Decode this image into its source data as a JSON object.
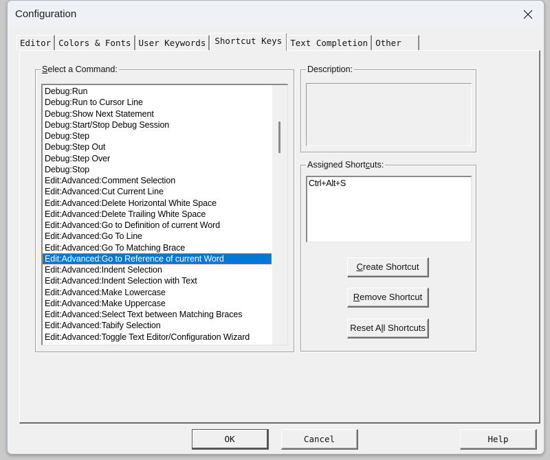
{
  "window": {
    "title": "Configuration",
    "close_icon": "close-icon"
  },
  "tabs": [
    {
      "label": "Editor",
      "active": false
    },
    {
      "label": "Colors & Fonts",
      "active": false
    },
    {
      "label": "User Keywords",
      "active": false
    },
    {
      "label": "Shortcut Keys",
      "active": true
    },
    {
      "label": "Text Completion",
      "active": false
    },
    {
      "label": "Other",
      "active": false
    }
  ],
  "commands": {
    "label_access": "S",
    "label_rest": "elect a Command:",
    "selected_index": 15,
    "items": [
      "Debug:Run",
      "Debug:Run to Cursor Line",
      "Debug:Show Next Statement",
      "Debug:Start/Stop Debug Session",
      "Debug:Step",
      "Debug:Step Out",
      "Debug:Step Over",
      "Debug:Stop",
      "Edit:Advanced:Comment Selection",
      "Edit:Advanced:Cut Current Line",
      "Edit:Advanced:Delete Horizontal White Space",
      "Edit:Advanced:Delete Trailing White Space",
      "Edit:Advanced:Go to Definition of current Word",
      "Edit:Advanced:Go To Line",
      "Edit:Advanced:Go To Matching Brace",
      "Edit:Advanced:Go to Reference of current Word",
      "Edit:Advanced:Indent Selection",
      "Edit:Advanced:Indent Selection with Text",
      "Edit:Advanced:Make Lowercase",
      "Edit:Advanced:Make Uppercase",
      "Edit:Advanced:Select Text between Matching Braces",
      "Edit:Advanced:Tabify Selection",
      "Edit:Advanced:Toggle Text Editor/Configuration Wizard"
    ]
  },
  "description": {
    "label": "Description:",
    "text": ""
  },
  "assigned_shortcuts": {
    "label_pre": "Assigned Short",
    "label_access": "c",
    "label_post": "uts:",
    "items": [
      "Ctrl+Alt+S"
    ]
  },
  "buttons": {
    "create": {
      "access": "C",
      "rest": "reate Shortcut"
    },
    "remove": {
      "access": "R",
      "rest": "emove Shortcut"
    },
    "reset": {
      "pre": "Reset A",
      "access": "l",
      "post": "l Shortcuts"
    },
    "ok": "OK",
    "cancel": "Cancel",
    "help": "Help"
  },
  "colors": {
    "selection": "#0078d7",
    "dialog_bg": "#f0f0f0"
  }
}
